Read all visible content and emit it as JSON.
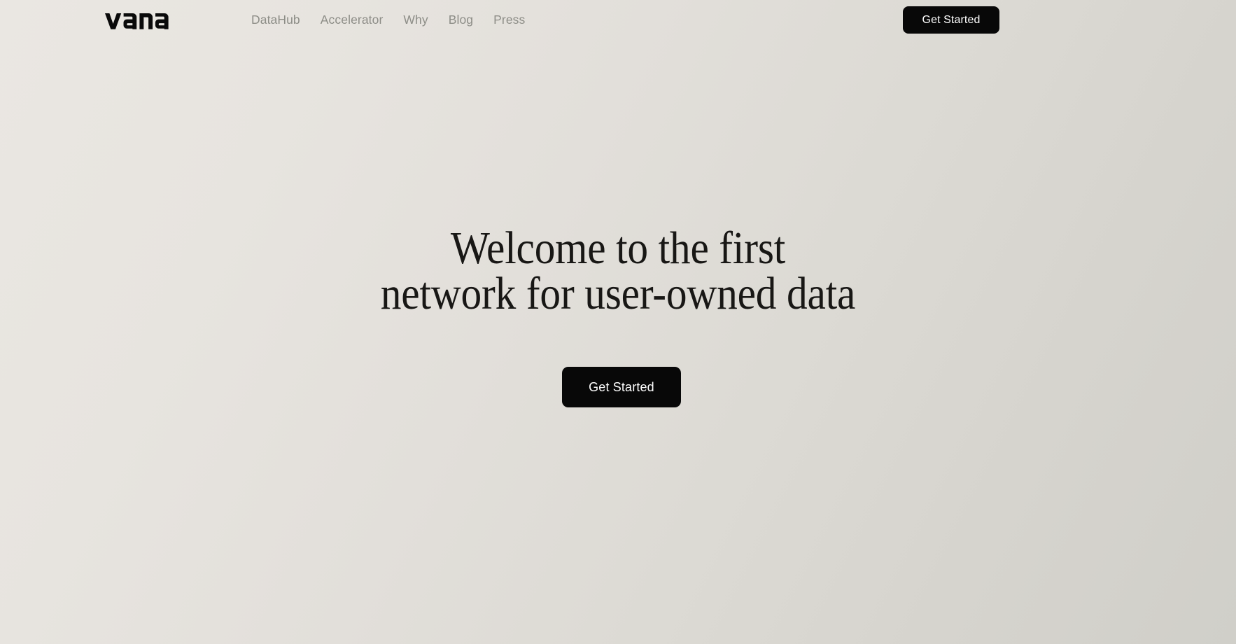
{
  "brand": {
    "logo_text": "vana",
    "logo_icon": "vana-wordmark"
  },
  "header": {
    "nav_items": [
      {
        "label": "DataHub"
      },
      {
        "label": "Accelerator"
      },
      {
        "label": "Why"
      },
      {
        "label": "Blog"
      },
      {
        "label": "Press"
      }
    ],
    "cta_label": "Get Started"
  },
  "hero": {
    "title_line_1": "Welcome to the first",
    "title_line_2": "network for user-owned data",
    "cta_label": "Get Started"
  },
  "colors": {
    "background_start": "#eae7e2",
    "background_end": "#d0cfc9",
    "text_primary": "#181715",
    "nav_text": "#8d8d87",
    "button_bg": "#080808",
    "button_text": "#ffffff"
  }
}
